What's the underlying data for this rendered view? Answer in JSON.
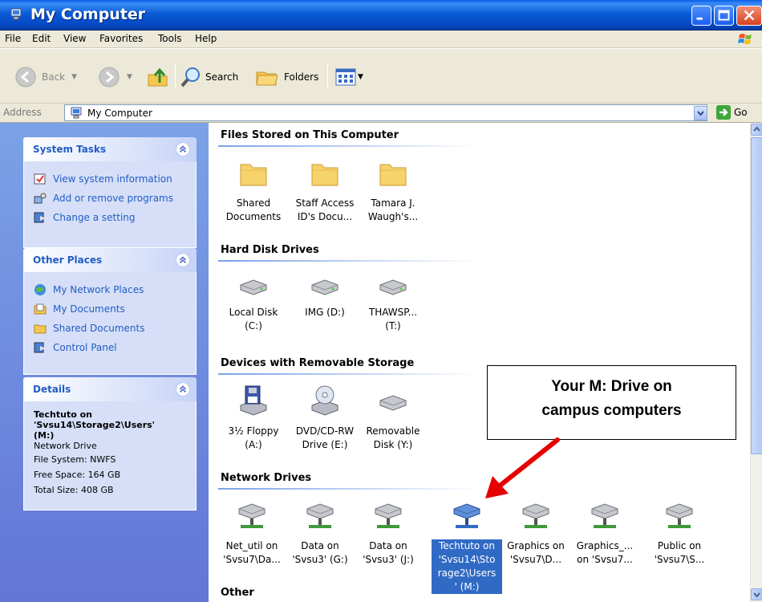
{
  "window": {
    "title": "My Computer",
    "controls": [
      "minimize-icon",
      "maximize-icon",
      "close-icon"
    ]
  },
  "menu": [
    "File",
    "Edit",
    "View",
    "Favorites",
    "Tools",
    "Help"
  ],
  "toolbar": {
    "back_label": "Back",
    "search_label": "Search",
    "folders_label": "Folders"
  },
  "address": {
    "label": "Address",
    "value": "My Computer",
    "go_label": "Go"
  },
  "system_tasks": {
    "title": "System Tasks",
    "items": [
      "View system information",
      "Add or remove programs",
      "Change a setting"
    ]
  },
  "other_places": {
    "title": "Other Places",
    "items": [
      "My Network Places",
      "My Documents",
      "Shared Documents",
      "Control Panel"
    ]
  },
  "details": {
    "title": "Details",
    "name_line1": "Techtuto on",
    "name_line2": "'Svsu14\\Storage2\\Users'",
    "name_line3": "(M:)",
    "type": "Network Drive",
    "file_system": "File System: NWFS",
    "free_space": "Free Space: 164 GB",
    "total_size": "Total Size: 408 GB"
  },
  "groups": {
    "files": {
      "title": "Files Stored on This Computer",
      "items": [
        {
          "l1": "Shared",
          "l2": "Documents"
        },
        {
          "l1": "Staff Access",
          "l2": "ID's Docu..."
        },
        {
          "l1": "Tamara J.",
          "l2": "Waugh's..."
        }
      ]
    },
    "hdd": {
      "title": "Hard Disk Drives",
      "items": [
        {
          "l1": "Local Disk",
          "l2": "(C:)"
        },
        {
          "l1": "IMG (D:)",
          "l2": ""
        },
        {
          "l1": "THAWSP...",
          "l2": "(T:)"
        }
      ]
    },
    "removable": {
      "title": "Devices with Removable Storage",
      "items": [
        {
          "l1": "3½ Floppy",
          "l2": "(A:)"
        },
        {
          "l1": "DVD/CD-RW",
          "l2": "Drive (E:)"
        },
        {
          "l1": "Removable",
          "l2": "Disk (Y:)"
        }
      ]
    },
    "network": {
      "title": "Network Drives",
      "items": [
        {
          "l1": "Net_util on",
          "l2": "'Svsu7\\Da...",
          "l3": "",
          "l4": ""
        },
        {
          "l1": "Data on",
          "l2": "'Svsu3' (G:)",
          "l3": "",
          "l4": ""
        },
        {
          "l1": "Data on",
          "l2": "'Svsu3' (J:)",
          "l3": "",
          "l4": ""
        },
        {
          "l1": "Techtuto on",
          "l2": "'Svsu14\\Sto",
          "l3": "rage2\\Users",
          "l4": "' (M:)"
        },
        {
          "l1": "Graphics on",
          "l2": "'Svsu7\\D...",
          "l3": "",
          "l4": ""
        },
        {
          "l1": "Graphics_...",
          "l2": "on 'Svsu7...",
          "l3": "",
          "l4": ""
        },
        {
          "l1": "Public on",
          "l2": "'Svsu7\\S...",
          "l3": "",
          "l4": ""
        }
      ]
    },
    "other": {
      "title": "Other"
    }
  },
  "callout": {
    "line1": "Your M: Drive on",
    "line2": "campus computers"
  },
  "colors": {
    "titlebar": "#0548c4",
    "pane": "#6f8fe0",
    "selection": "#316ac5",
    "arrow": "#e60000"
  }
}
